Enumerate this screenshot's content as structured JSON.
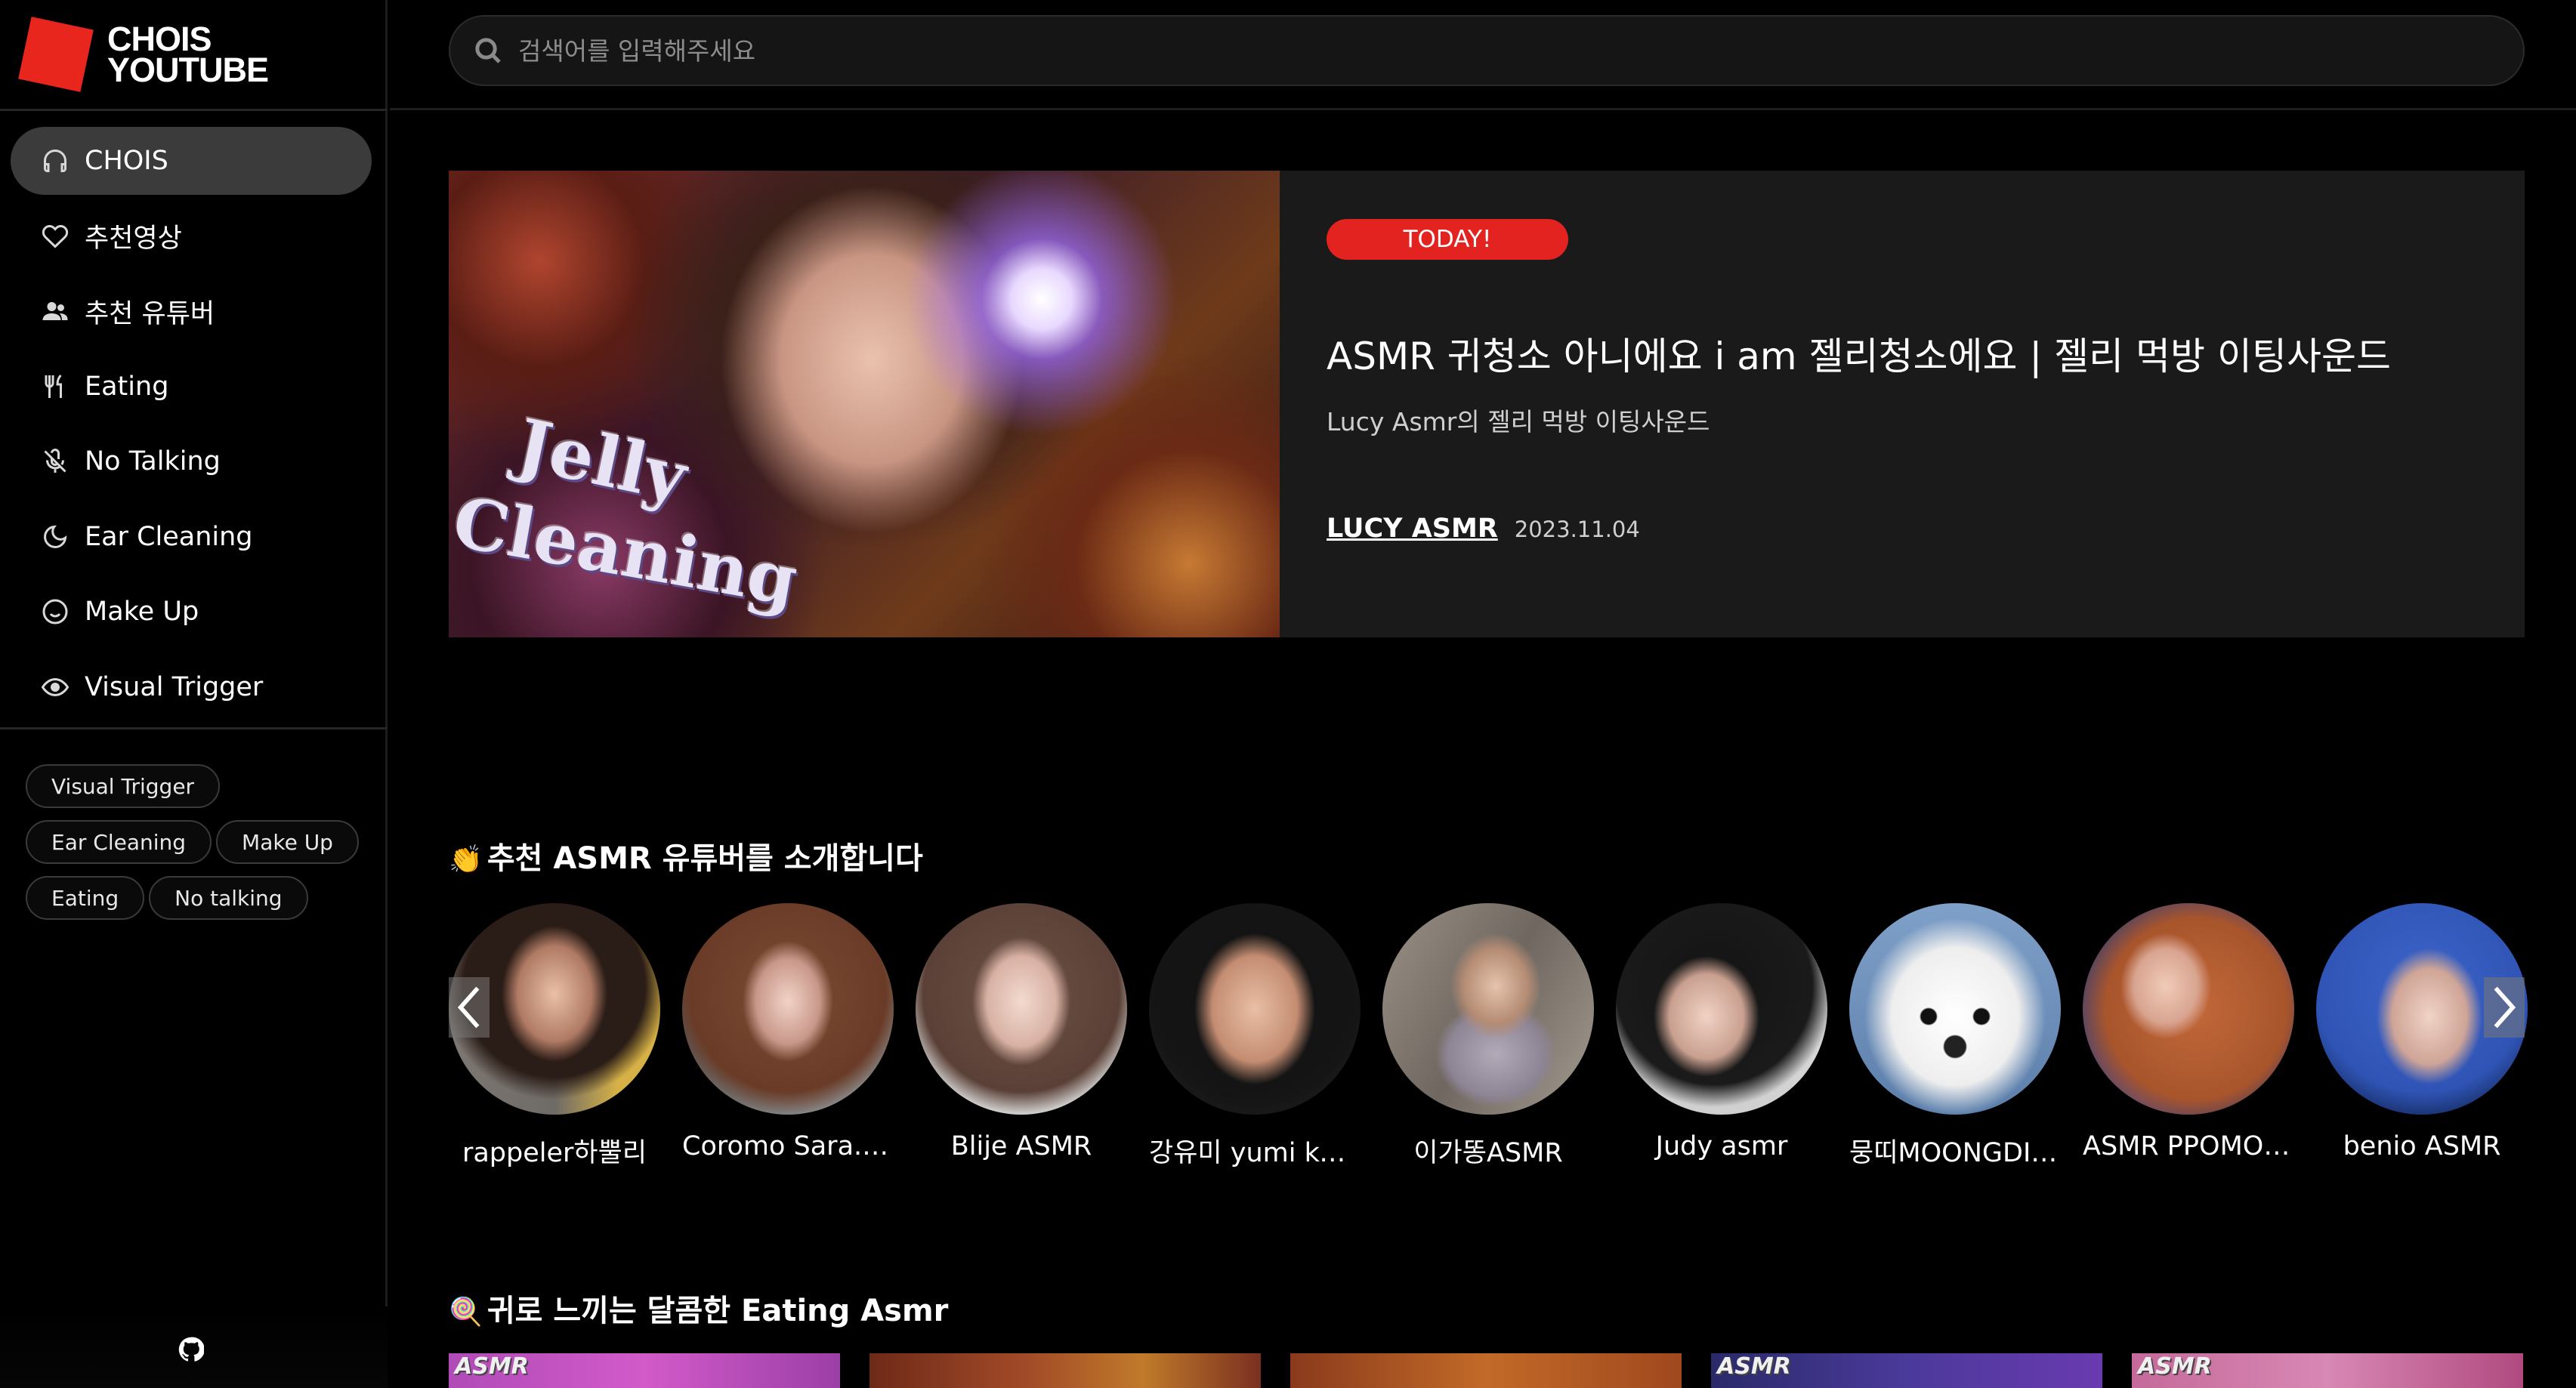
{
  "brand": {
    "line1": "CHOIS",
    "line2": "YOUTUBE",
    "color": "#e8261d"
  },
  "search": {
    "placeholder": "검색어를 입력해주세요",
    "icon": "search-icon"
  },
  "sidebar": {
    "items": [
      {
        "label": "CHOIS",
        "icon": "headphones-icon",
        "active": true
      },
      {
        "label": "추천영상",
        "icon": "heart-icon"
      },
      {
        "label": "추천 유튜버",
        "icon": "users-icon"
      },
      {
        "label": "Eating",
        "icon": "utensils-icon"
      },
      {
        "label": "No Talking",
        "icon": "mic-off-icon"
      },
      {
        "label": "Ear Cleaning",
        "icon": "moon-icon"
      },
      {
        "label": "Make Up",
        "icon": "smile-icon"
      },
      {
        "label": "Visual Trigger",
        "icon": "eye-icon"
      }
    ],
    "tags": [
      [
        "Visual Trigger"
      ],
      [
        "Ear Cleaning",
        "Make Up"
      ],
      [
        "Eating",
        "No talking"
      ]
    ],
    "footer_icon": "github-icon"
  },
  "featured": {
    "badge": "TODAY!",
    "title": "ASMR 귀청소 아니에요 i am 젤리청소에요 | 젤리 먹방 이팅사운드",
    "description": "Lucy Asmr의 젤리 먹방 이팅사운드",
    "channel": "LUCY ASMR",
    "date": "2023.11.04",
    "thumbnail_text": [
      "Jelly",
      "Cleaning"
    ],
    "badge_color": "#e3231f"
  },
  "youtubers": {
    "heading": "추천 ASMR 유튜버를 소개합니다",
    "emoji": "👏",
    "items": [
      {
        "name": "rappeler하뿔리"
      },
      {
        "name": "Coromo Sara. A..."
      },
      {
        "name": "Blije ASMR"
      },
      {
        "name": "강유미 yumi kan..."
      },
      {
        "name": "이가똥ASMR"
      },
      {
        "name": "Judy asmr"
      },
      {
        "name": "뭉띠MOONGDI A..."
      },
      {
        "name": "ASMR PPOMO ..."
      },
      {
        "name": "benio ASMR"
      }
    ],
    "prev_icon": "chevron-left-icon",
    "next_icon": "chevron-right-icon"
  },
  "eating": {
    "heading": "귀로 느끼는 달콤한 Eating Asmr",
    "emoji": "🍭",
    "thumbs": [
      {
        "label": "ASMR"
      },
      {
        "label": ""
      },
      {
        "label": ""
      },
      {
        "label": "ASMR"
      },
      {
        "label": "ASMR"
      }
    ]
  }
}
